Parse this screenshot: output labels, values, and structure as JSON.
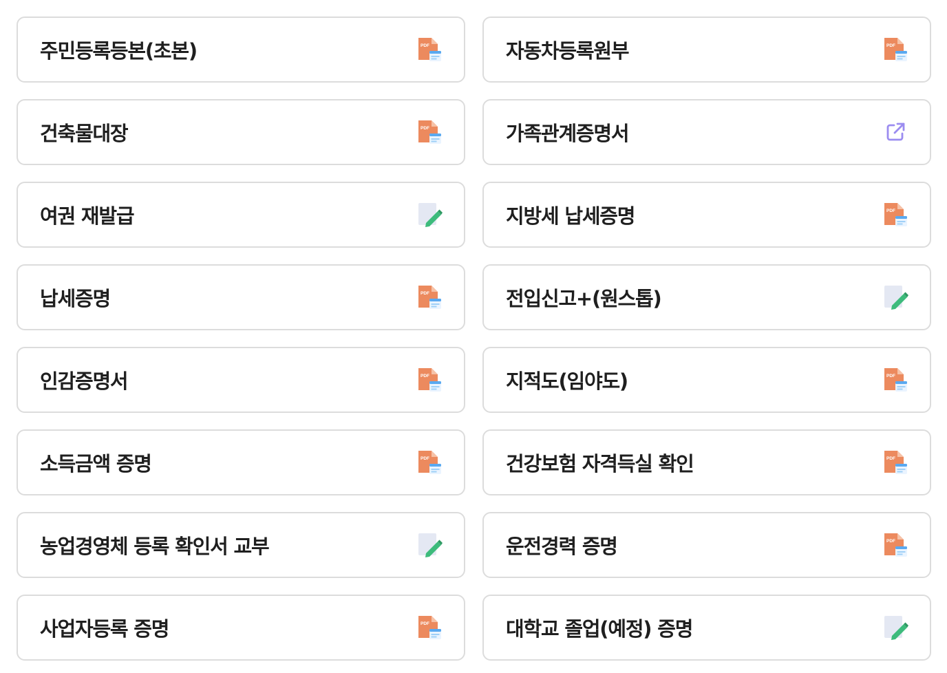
{
  "services": [
    {
      "label": "주민등록등본(초본)",
      "icon": "pdf-file-icon"
    },
    {
      "label": "자동차등록원부",
      "icon": "pdf-file-icon"
    },
    {
      "label": "건축물대장",
      "icon": "pdf-file-icon"
    },
    {
      "label": "가족관계증명서",
      "icon": "external-link-icon"
    },
    {
      "label": "여권 재발급",
      "icon": "edit-document-icon"
    },
    {
      "label": "지방세 납세증명",
      "icon": "pdf-file-icon"
    },
    {
      "label": "납세증명",
      "icon": "pdf-file-icon"
    },
    {
      "label": "전입신고+(원스톱)",
      "icon": "edit-document-icon"
    },
    {
      "label": "인감증명서",
      "icon": "pdf-file-icon"
    },
    {
      "label": "지적도(임야도)",
      "icon": "pdf-file-icon"
    },
    {
      "label": "소득금액 증명",
      "icon": "pdf-file-icon"
    },
    {
      "label": "건강보험 자격득실 확인",
      "icon": "pdf-file-icon"
    },
    {
      "label": "농업경영체 등록 확인서 교부",
      "icon": "edit-document-icon"
    },
    {
      "label": "운전경력 증명",
      "icon": "pdf-file-icon"
    },
    {
      "label": "사업자등록 증명",
      "icon": "pdf-file-icon"
    },
    {
      "label": "대학교 졸업(예정) 증명",
      "icon": "edit-document-icon"
    }
  ],
  "colors": {
    "pdf_icon": "#ec8a5e",
    "pdf_window": "#5aa9f0",
    "external_link_icon": "#9b8cf0",
    "edit_icon_paper": "#e4e8f3",
    "edit_icon_pencil": "#3dbb7c",
    "card_border": "#dcdcdc",
    "label_text": "#1f1f1f"
  }
}
